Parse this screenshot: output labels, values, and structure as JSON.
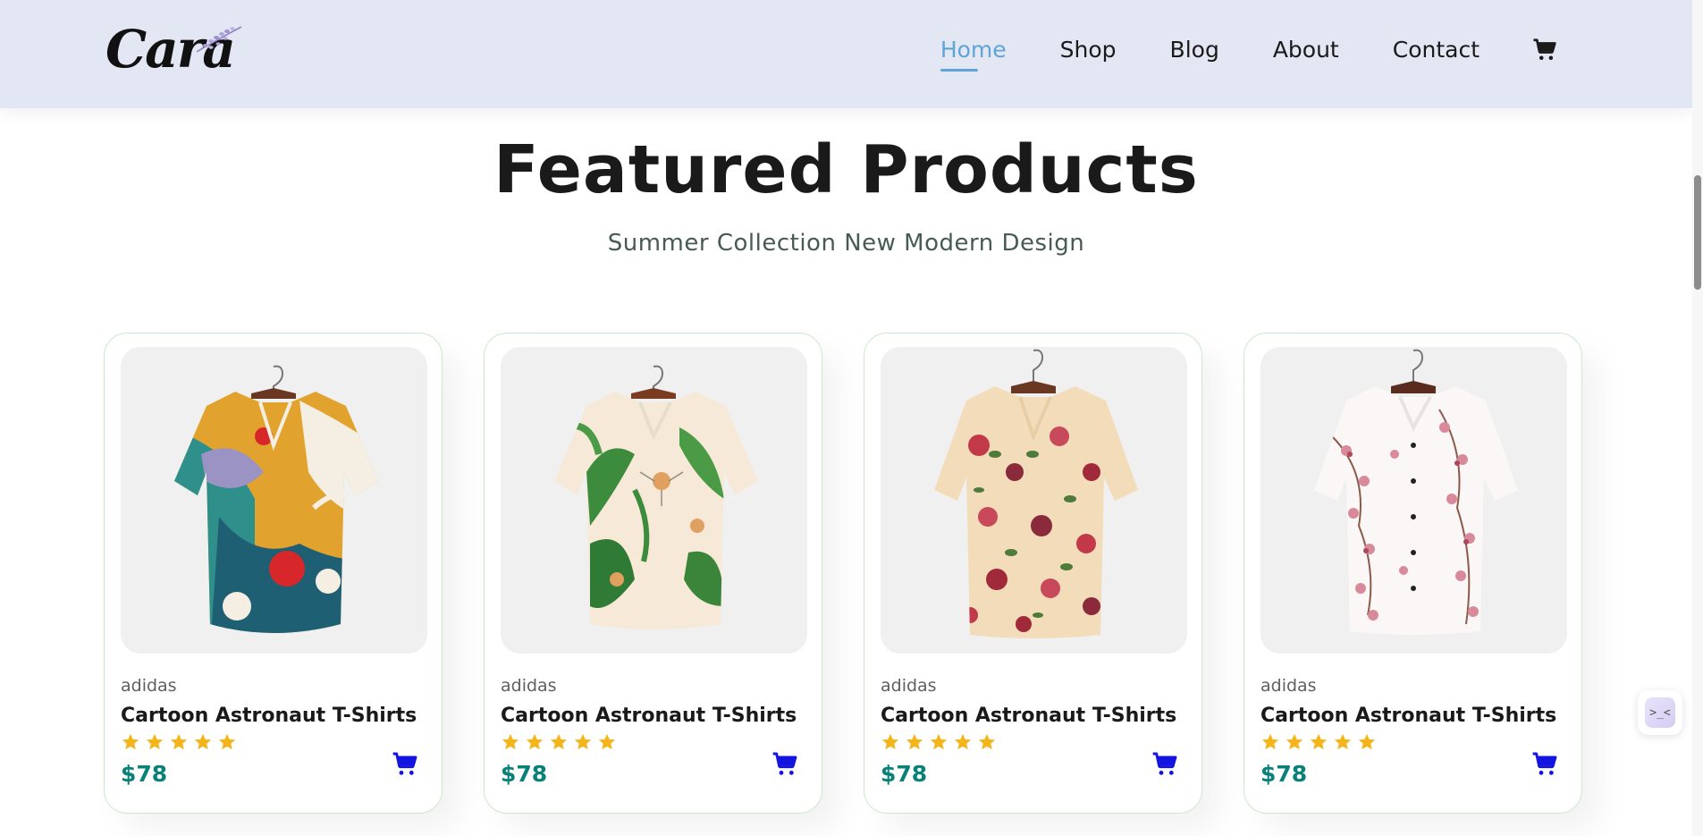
{
  "header": {
    "logo_text": "Cara",
    "nav": [
      {
        "label": "Home",
        "active": true
      },
      {
        "label": "Shop",
        "active": false
      },
      {
        "label": "Blog",
        "active": false
      },
      {
        "label": "About",
        "active": false
      },
      {
        "label": "Contact",
        "active": false
      }
    ],
    "cart_icon": "cart-icon"
  },
  "section": {
    "title": "Featured Products",
    "subtitle": "Summer Collection New Modern Design"
  },
  "products": [
    {
      "brand": "adidas",
      "name": "Cartoon Astronaut T-Shirts",
      "rating": 5,
      "price": "$78",
      "image": "abstract-print-shirt"
    },
    {
      "brand": "adidas",
      "name": "Cartoon Astronaut T-Shirts",
      "rating": 5,
      "price": "$78",
      "image": "lily-print-shirt"
    },
    {
      "brand": "adidas",
      "name": "Cartoon Astronaut T-Shirts",
      "rating": 5,
      "price": "$78",
      "image": "rose-print-shirt"
    },
    {
      "brand": "adidas",
      "name": "Cartoon Astronaut T-Shirts",
      "rating": 5,
      "price": "$78",
      "image": "blossom-print-shirt"
    }
  ],
  "widget": {
    "label": ">_<"
  },
  "colors": {
    "header_bg": "#e3e6f3",
    "nav_active": "#5fa4d6",
    "price": "#088178",
    "star": "#f3b519",
    "cart_button": "#1414e0",
    "card_border": "#cce7d0"
  }
}
